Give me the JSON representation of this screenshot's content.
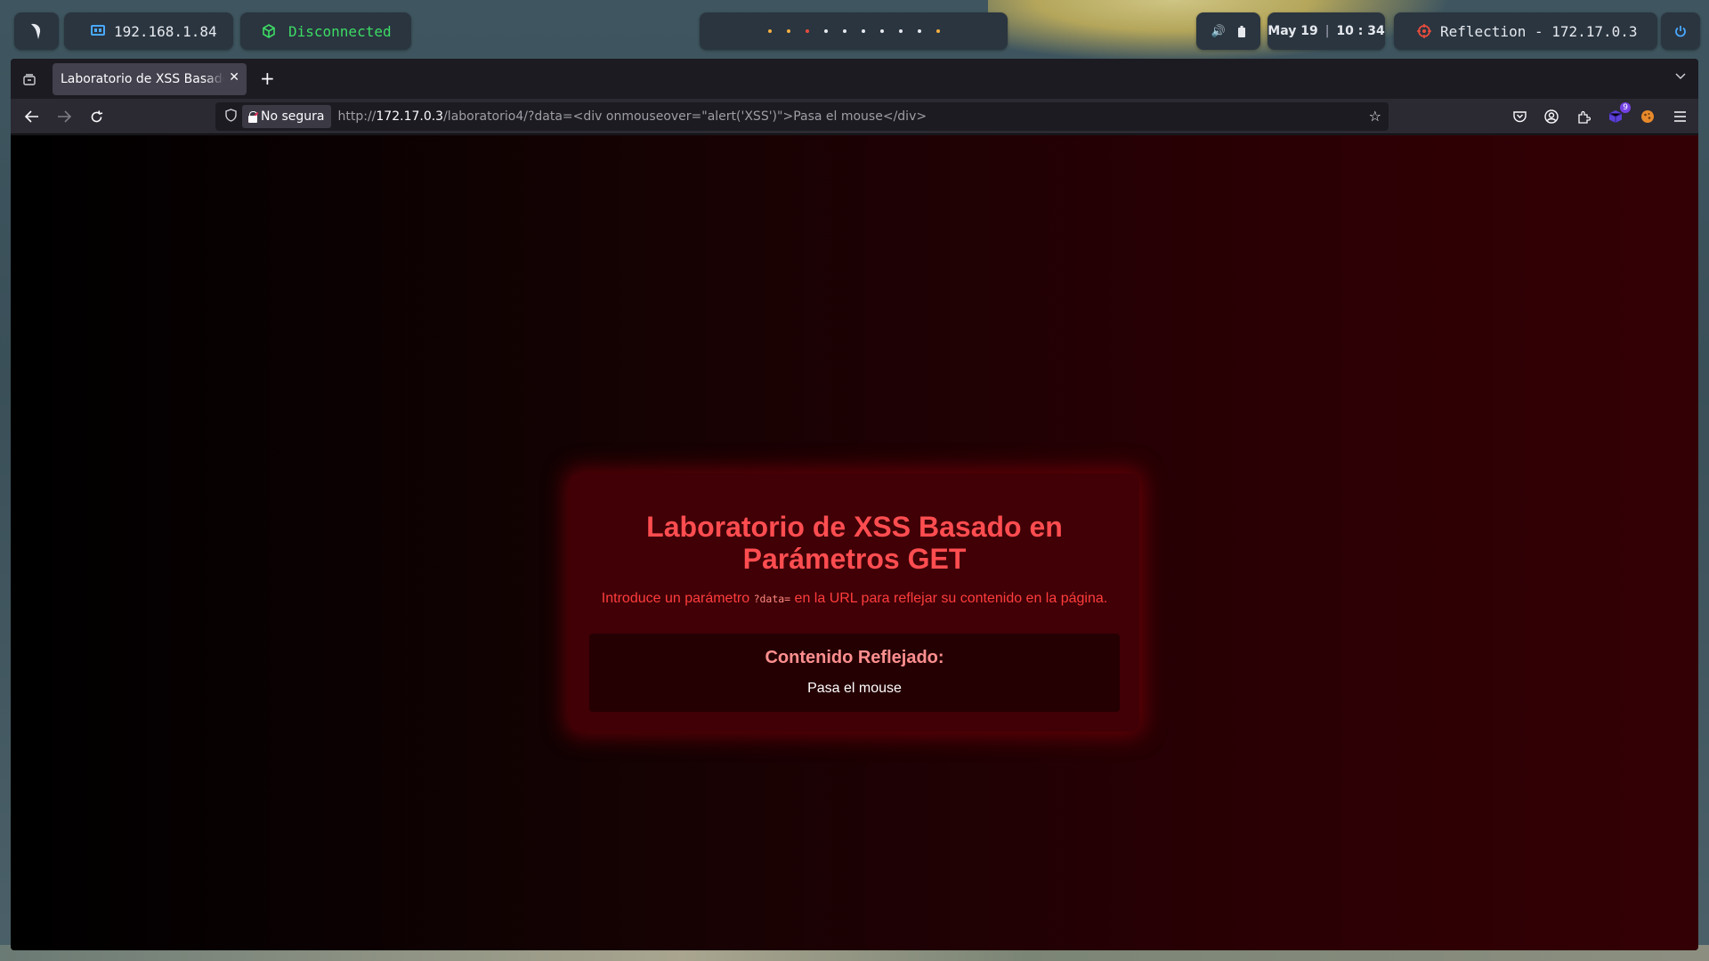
{
  "panel": {
    "ip": "192.168.1.84",
    "vpn_status": "Disconnected",
    "date": "May 19",
    "time": "10 : 34",
    "target": "Reflection - 172.17.0.3",
    "workspace_dot_colors": [
      "#f5b041",
      "#f5b041",
      "#e74c3c",
      "#e6e9ee",
      "#e6e9ee",
      "#e6e9ee",
      "#e6e9ee",
      "#e6e9ee",
      "#e6e9ee",
      "#f5b041"
    ]
  },
  "browser": {
    "tab_title": "Laboratorio de XSS Basado en Parámetros GET",
    "security_label": "No segura",
    "url_prefix": "http://",
    "url_host": "172.17.0.3",
    "url_path": "/laboratorio4/?data=<div onmouseover=\"alert('XSS')\">Pasa el mouse</div>",
    "extension_badge": "9"
  },
  "page": {
    "title": "Laboratorio de XSS Basado en Parámetros GET",
    "subtitle_before": "Introduce un parámetro ",
    "subtitle_code": "?data=",
    "subtitle_after": " en la URL para reflejar su contenido en la página.",
    "reflected_heading": "Contenido Reflejado:",
    "reflected_value": "Pasa el mouse"
  },
  "colors": {
    "accent_red": "#ff4d50",
    "vpn_green": "#3ddc64",
    "power_blue": "#4aa8ff"
  }
}
